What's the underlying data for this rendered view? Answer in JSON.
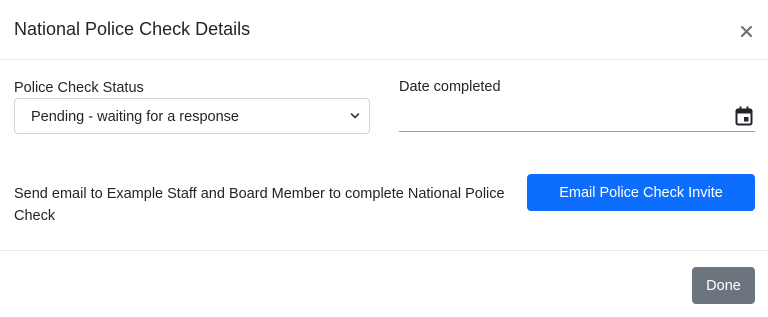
{
  "header": {
    "title": "National Police Check Details",
    "close_icon": "close-icon"
  },
  "form": {
    "status": {
      "label": "Police Check Status",
      "selected_value": "Pending - waiting for a response",
      "icon": "chevron-down-icon"
    },
    "date_completed": {
      "label": "Date completed",
      "value": "",
      "icon": "calendar-icon"
    }
  },
  "invite": {
    "message": "Send email to Example Staff and Board Member to complete National Police Check",
    "button_label": "Email Police Check Invite"
  },
  "footer": {
    "done_label": "Done"
  },
  "colors": {
    "primary": "#0d6efd",
    "secondary": "#6c757d",
    "text": "#212529",
    "border": "#ced4da",
    "divider": "#e9ecef"
  }
}
